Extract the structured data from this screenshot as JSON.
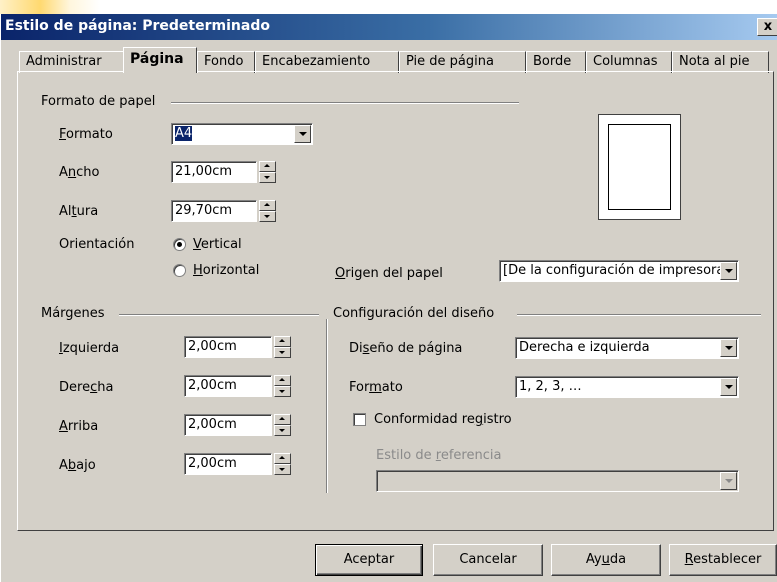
{
  "window": {
    "title": "Estilo de página: Predeterminado",
    "close_label": "x"
  },
  "tabs": [
    {
      "label": "Administrar",
      "active": false
    },
    {
      "label": "Página",
      "active": true
    },
    {
      "label": "Fondo",
      "active": false
    },
    {
      "label": "Encabezamiento",
      "active": false
    },
    {
      "label": "Pie de página",
      "active": false
    },
    {
      "label": "Borde",
      "active": false
    },
    {
      "label": "Columnas",
      "active": false
    },
    {
      "label": "Nota al pie",
      "active": false
    }
  ],
  "paper_format": {
    "group_label": "Formato de papel",
    "format": {
      "label_u": "F",
      "label_rest": "ormato",
      "value": "A4"
    },
    "width": {
      "label_pre": "A",
      "label_u": "n",
      "label_rest": "cho",
      "value": "21,00cm"
    },
    "height": {
      "label_pre": "Al",
      "label_u": "t",
      "label_rest": "ura",
      "value": "29,70cm"
    },
    "orientation": {
      "label": "Orientación",
      "vertical": {
        "label_u": "V",
        "label_rest": "ertical",
        "checked": true
      },
      "horizontal": {
        "label_u": "H",
        "label_rest": "orizontal",
        "checked": false
      }
    },
    "paper_source": {
      "label_u": "O",
      "label_rest": "rigen del papel",
      "value": "[De la configuración de impresora]"
    }
  },
  "margins": {
    "group_label": "Márgenes",
    "left": {
      "label_u": "I",
      "label_rest": "zquierda",
      "value": "2,00cm"
    },
    "right": {
      "label_pre": "Dere",
      "label_u": "c",
      "label_rest": "ha",
      "value": "2,00cm"
    },
    "top": {
      "label_u": "A",
      "label_rest": "rriba",
      "value": "2,00cm"
    },
    "bottom": {
      "label_pre": "A",
      "label_u": "b",
      "label_rest": "ajo",
      "value": "2,00cm"
    }
  },
  "layout_settings": {
    "group_label": "Configuración del diseño",
    "page_layout": {
      "label_pre": "Di",
      "label_u": "s",
      "label_rest": "eño de página",
      "value": "Derecha e izquierda"
    },
    "format": {
      "label_pre": "For",
      "label_u": "m",
      "label_rest": "ato",
      "value": "1, 2, 3, …"
    },
    "register_true": {
      "label_pre": "Conformidad re",
      "label_u": "g",
      "label_rest": "istro",
      "checked": false
    },
    "reference_style": {
      "label_pre": "Estilo de ",
      "label_u": "r",
      "label_rest": "eferencia",
      "value": ""
    }
  },
  "buttons": {
    "ok": "Aceptar",
    "cancel": "Cancelar",
    "help_pre": "Ay",
    "help_u": "u",
    "help_rest": "da",
    "reset_u": "R",
    "reset_rest": "establecer"
  }
}
